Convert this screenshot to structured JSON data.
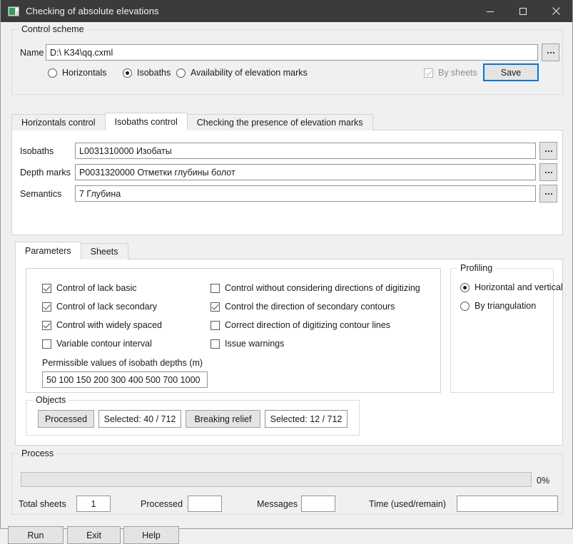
{
  "window": {
    "title": "Checking of absolute elevations",
    "icon": "app-icon",
    "controls": {
      "minimize": "minimize-icon",
      "maximize": "maximize-icon",
      "close": "close-icon"
    }
  },
  "control_scheme": {
    "group_title": "Control scheme",
    "name_label": "Name",
    "name_value": "D:\\ K34\\qq.cxml",
    "browse_label": "...",
    "radios": [
      {
        "label": "Horizontals",
        "checked": false
      },
      {
        "label": "Isobaths",
        "checked": true
      },
      {
        "label": "Availability of elevation marks",
        "checked": false
      }
    ],
    "by_sheets": {
      "label": "By sheets",
      "checked": true,
      "disabled": true
    },
    "save_label": "Save"
  },
  "main_tabs": [
    {
      "label": "Horizontals control",
      "active": false
    },
    {
      "label": "Isobaths control",
      "active": true
    },
    {
      "label": "Checking the presence of elevation marks",
      "active": false
    }
  ],
  "isobaths_panel": {
    "rows": [
      {
        "label": "Isobaths",
        "value": "L0031310000  Изобаты",
        "browse": "..."
      },
      {
        "label": "Depth marks",
        "value": "P0031320000  Отметки глубины болот",
        "browse": "..."
      },
      {
        "label": "Semantics",
        "value": "7  Глубина",
        "browse": "..."
      }
    ]
  },
  "param_tabs": [
    {
      "label": "Parameters",
      "active": true
    },
    {
      "label": "Sheets",
      "active": false
    }
  ],
  "parameters": {
    "left_checks": [
      {
        "label": "Control of lack basic",
        "checked": true
      },
      {
        "label": "Control of lack secondary",
        "checked": true
      },
      {
        "label": "Control with widely spaced",
        "checked": true
      },
      {
        "label": "Variable contour interval",
        "checked": false
      }
    ],
    "right_checks": [
      {
        "label": "Control without considering directions of digitizing",
        "checked": false
      },
      {
        "label": "Control the direction of secondary contours",
        "checked": true
      },
      {
        "label": "Correct direction of digitizing contour lines",
        "checked": false
      },
      {
        "label": "Issue warnings",
        "checked": false
      }
    ],
    "depths_label": "Permissible values of isobath depths (m)",
    "depths_value": "50 100 150 200 300 400 500 700 1000"
  },
  "profiling": {
    "group_title": "Profiling",
    "options": [
      {
        "label": "Horizontal and vertical",
        "checked": true
      },
      {
        "label": "By triangulation",
        "checked": false
      }
    ]
  },
  "objects": {
    "group_title": "Objects",
    "processed_button": "Processed",
    "processed_count": "Selected: 40 / 712",
    "breaking_button": "Breaking relief",
    "breaking_count": "Selected: 12 / 712"
  },
  "process": {
    "group_title": "Process",
    "progress_percent": "0%",
    "progress_value": 0,
    "total_sheets_label": "Total sheets",
    "total_sheets_value": "1",
    "processed_label": "Processed",
    "processed_value": "",
    "messages_label": "Messages",
    "messages_value": "",
    "time_label": "Time (used/remain)",
    "time_value": ""
  },
  "footer": {
    "run_label": "Run",
    "exit_label": "Exit",
    "help_label": "Help"
  },
  "colors": {
    "titlebar": "#3b3b3b",
    "body": "#f0f0f0",
    "panel": "#ffffff",
    "accent": "#0078d7",
    "field_border": "#949494"
  }
}
